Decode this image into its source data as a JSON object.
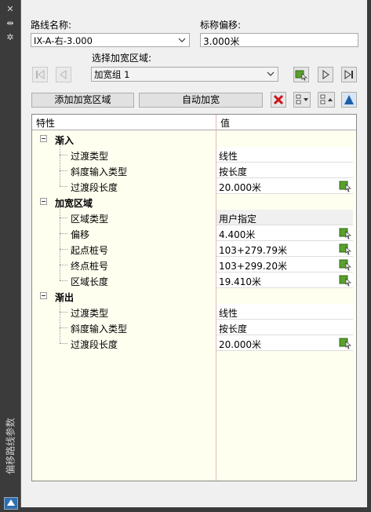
{
  "sidebar": {
    "title": "偏移路线参数",
    "close_glyph": "✕",
    "pin_glyph": "⇹",
    "settings_glyph": "✲"
  },
  "form": {
    "route_label": "路线名称:",
    "route_value": "IX-A-右-3.000",
    "offset_label": "标称偏移:",
    "offset_value": "3.000米",
    "region_label": "选择加宽区域:",
    "region_value": "加宽组 1"
  },
  "buttons": {
    "add_region": "添加加宽区域",
    "auto_widen": "自动加宽"
  },
  "grid": {
    "col_property": "特性",
    "col_value": "值",
    "groups": [
      {
        "label": "渐入",
        "rows": [
          {
            "name": "过渡类型",
            "value": "线性",
            "pick": false
          },
          {
            "name": "斜度输入类型",
            "value": "按长度",
            "pick": false
          },
          {
            "name": "过渡段长度",
            "value": "20.000米",
            "pick": true
          }
        ]
      },
      {
        "label": "加宽区域",
        "rows": [
          {
            "name": "区域类型",
            "value": "用户指定",
            "pick": false,
            "gray": true
          },
          {
            "name": "偏移",
            "value": "4.400米",
            "pick": true
          },
          {
            "name": "起点桩号",
            "value": "103+279.79米",
            "pick": true
          },
          {
            "name": "终点桩号",
            "value": "103+299.20米",
            "pick": true
          },
          {
            "name": "区域长度",
            "value": "19.410米",
            "pick": true
          }
        ]
      },
      {
        "label": "渐出",
        "rows": [
          {
            "name": "过渡类型",
            "value": "线性",
            "pick": false
          },
          {
            "name": "斜度输入类型",
            "value": "按长度",
            "pick": false
          },
          {
            "name": "过渡段长度",
            "value": "20.000米",
            "pick": true
          }
        ]
      }
    ]
  }
}
